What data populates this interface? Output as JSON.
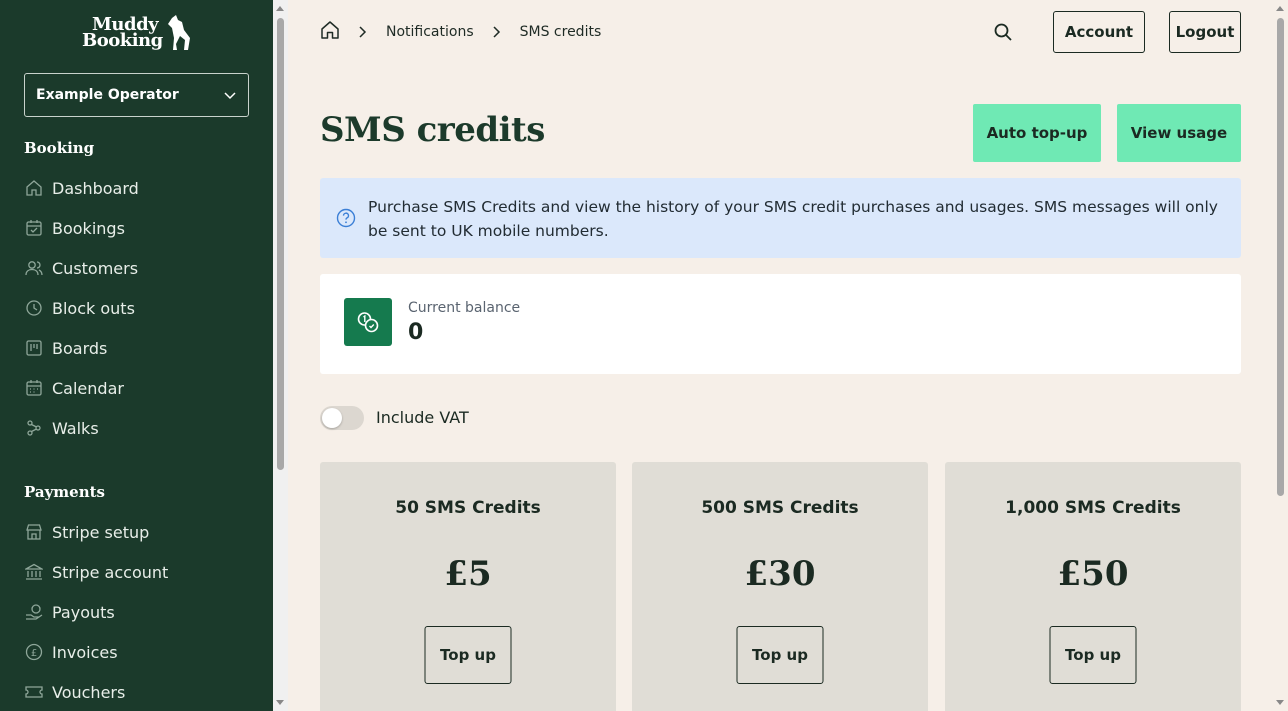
{
  "brand": {
    "line1": "Muddy",
    "line2": "Booking"
  },
  "operator": {
    "selected": "Example Operator"
  },
  "sidebar": {
    "booking_title": "Booking",
    "booking_items": [
      {
        "label": "Dashboard",
        "icon": "home-icon"
      },
      {
        "label": "Bookings",
        "icon": "calendar-check-icon"
      },
      {
        "label": "Customers",
        "icon": "users-icon"
      },
      {
        "label": "Block outs",
        "icon": "clock-icon"
      },
      {
        "label": "Boards",
        "icon": "board-icon"
      },
      {
        "label": "Calendar",
        "icon": "calendar-icon"
      },
      {
        "label": "Walks",
        "icon": "paw-icon"
      }
    ],
    "payments_title": "Payments",
    "payment_items": [
      {
        "label": "Stripe setup",
        "icon": "store-icon"
      },
      {
        "label": "Stripe account",
        "icon": "bank-icon"
      },
      {
        "label": "Payouts",
        "icon": "payout-icon"
      },
      {
        "label": "Invoices",
        "icon": "pound-icon"
      },
      {
        "label": "Vouchers",
        "icon": "ticket-icon"
      }
    ]
  },
  "breadcrumb": {
    "items": [
      "Notifications",
      "SMS credits"
    ]
  },
  "header": {
    "account_label": "Account",
    "logout_label": "Logout"
  },
  "page": {
    "title": "SMS credits",
    "auto_topup_label": "Auto top-up",
    "view_usage_label": "View usage",
    "info_text": "Purchase SMS Credits and view the history of your SMS credit purchases and usages. SMS messages will only be sent to UK mobile numbers.",
    "balance_label": "Current balance",
    "balance_value": "0",
    "vat_label": "Include VAT",
    "vat_enabled": false,
    "packages": [
      {
        "title": "50 SMS Credits",
        "price": "£5",
        "button": "Top up"
      },
      {
        "title": "500 SMS Credits",
        "price": "£30",
        "button": "Top up"
      },
      {
        "title": "1,000 SMS Credits",
        "price": "£50",
        "button": "Top up"
      }
    ]
  },
  "colors": {
    "sidebar_bg": "#1b3a2b",
    "accent": "#6fe9b4",
    "info_bg": "#dbe8fb",
    "coin_bg": "#157a4e",
    "page_bg": "#f6efe8"
  }
}
